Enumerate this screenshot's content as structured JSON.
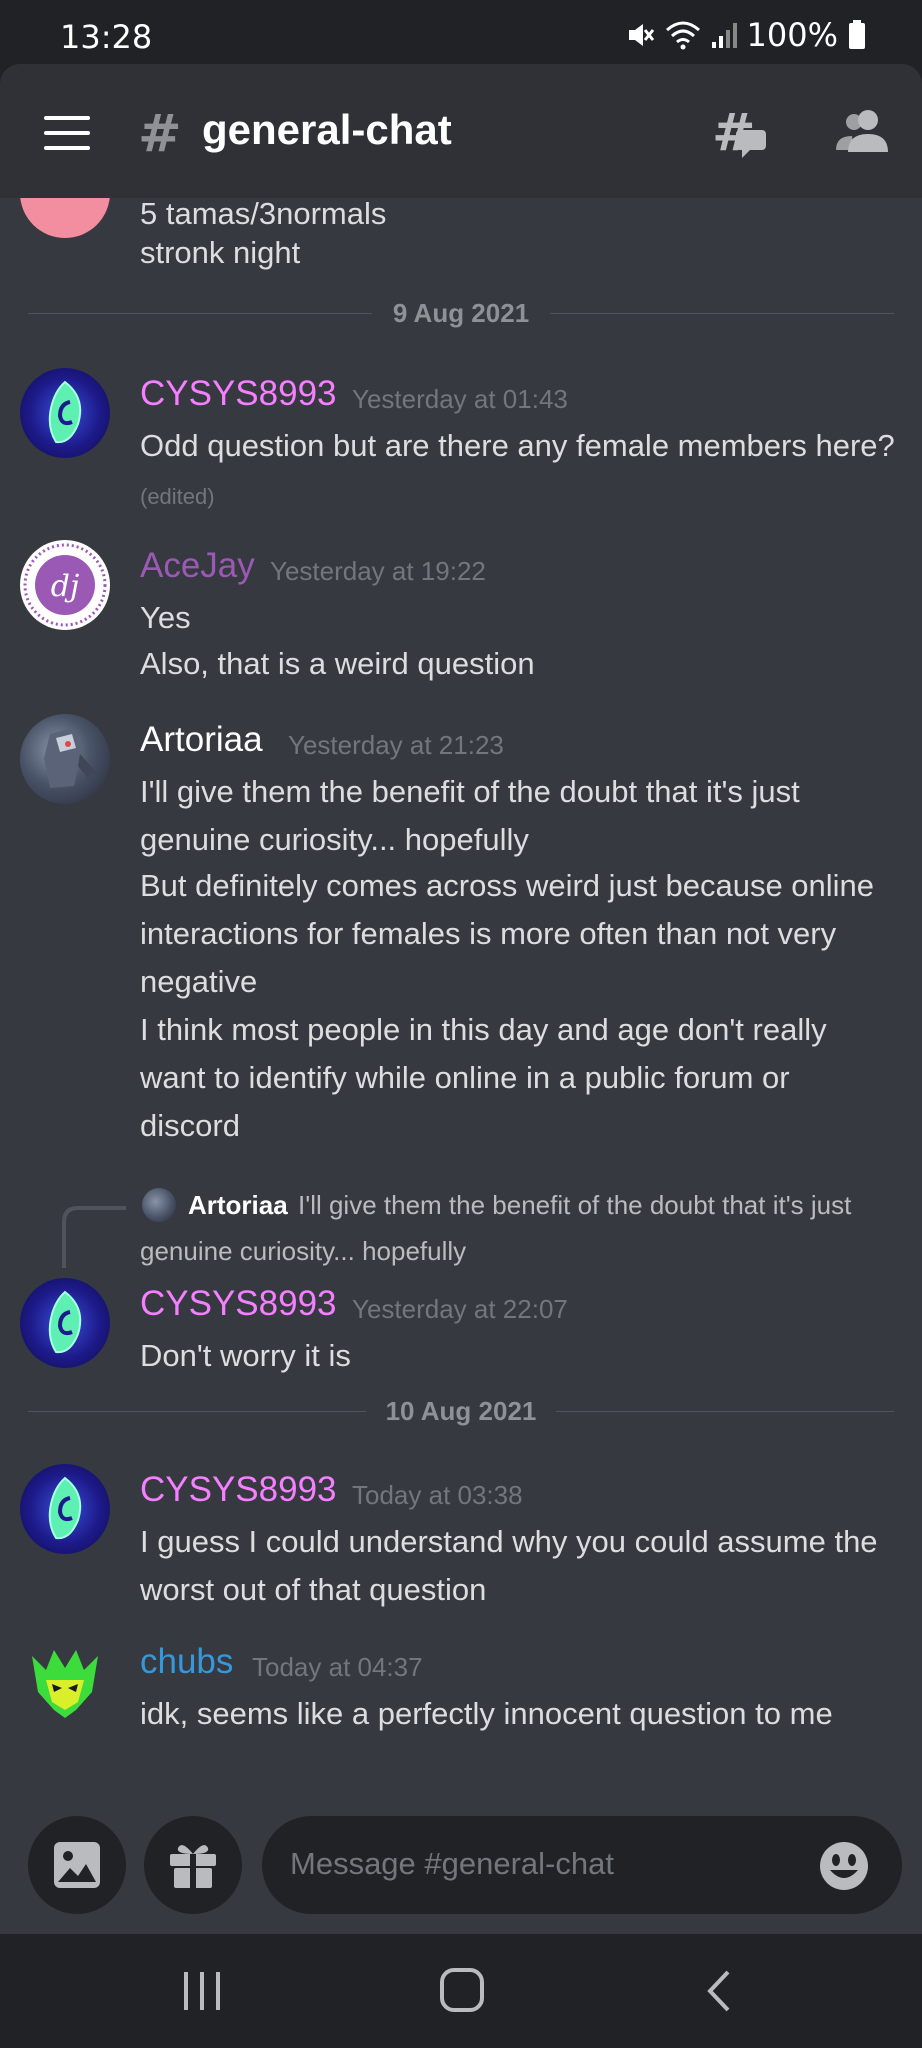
{
  "status": {
    "time": "13:28",
    "battery": "100%"
  },
  "header": {
    "channel_name": "general-chat"
  },
  "colors": {
    "cysys": "#f47fff",
    "acejay": "#9b59b6",
    "artoriaa": "#ffffff",
    "chubs": "#3498db"
  },
  "messages": {
    "top_partial": {
      "lines": [
        "5 tamas/3normals",
        "stronk night"
      ]
    },
    "divider1": "9 Aug 2021",
    "m1": {
      "user": "CYSYS8993",
      "time": "Yesterday at 01:43",
      "lines": [
        "Odd question but are there any female members here?"
      ],
      "edited": "(edited)"
    },
    "m2": {
      "user": "AceJay",
      "time": "Yesterday at 19:22",
      "lines": [
        "Yes",
        "Also, that is a weird question"
      ]
    },
    "m3": {
      "user": "Artoriaa",
      "time": "Yesterday at 21:23",
      "lines": [
        "I'll give them the benefit of the doubt that it's just",
        "genuine curiosity... hopefully",
        "But definitely comes across weird just because online",
        "interactions for females is more often than not very",
        "negative",
        "I think most people in this day and age don't really",
        "want to identify while online in a public forum or",
        "discord"
      ]
    },
    "m4": {
      "reply_user": "Artoriaa",
      "reply_text_1": "I'll give them the benefit of the doubt that it's just",
      "reply_text_2": "genuine curiosity... hopefully",
      "user": "CYSYS8993",
      "time": "Yesterday at 22:07",
      "lines": [
        "Don't worry it is"
      ]
    },
    "divider2": "10 Aug 2021",
    "m5": {
      "user": "CYSYS8993",
      "time": "Today at 03:38",
      "lines": [
        "I guess I could understand why you could assume the",
        "worst out of that question"
      ]
    },
    "m6": {
      "user": "chubs",
      "time": "Today at 04:37",
      "lines": [
        "idk, seems like a perfectly innocent question to me"
      ]
    }
  },
  "composer": {
    "placeholder": "Message #general-chat"
  },
  "icons": {
    "menu": "hamburger-menu-icon",
    "threads": "threads-icon",
    "members": "members-icon",
    "image": "image-icon",
    "gift": "gift-icon",
    "emoji": "emoji-icon"
  }
}
